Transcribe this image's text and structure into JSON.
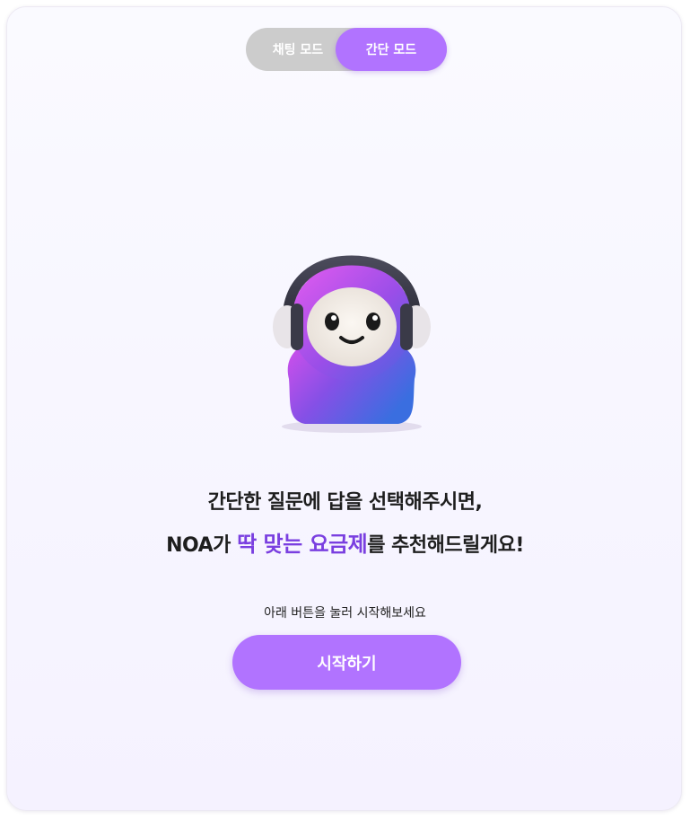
{
  "mode_toggle": {
    "options": [
      "채팅 모드",
      "간단 모드"
    ],
    "selected": "간단 모드"
  },
  "headline": {
    "line1": "간단한 질문에 답을 선택해주시면,",
    "line2_prefix": "NOA가 ",
    "line2_highlight": "딱 맞는 요금제",
    "line2_suffix": "를 추천해드릴게요!"
  },
  "hint": "아래 버튼을 눌러 시작해보세요",
  "start_button_label": "시작하기",
  "colors": {
    "accent": "#b173ff",
    "highlight_text": "#7a3fe0",
    "toggle_inactive": "#cccccc"
  },
  "mascot_icon": "noa-mascot-icon"
}
